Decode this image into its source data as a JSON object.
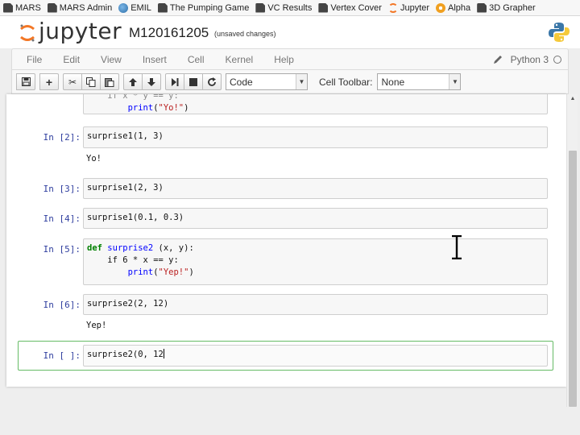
{
  "bookmarks": [
    {
      "label": "MARS",
      "icon": "page-icon"
    },
    {
      "label": "MARS Admin",
      "icon": "page-icon"
    },
    {
      "label": "EMIL",
      "icon": "globe-icon"
    },
    {
      "label": "The Pumping Game",
      "icon": "page-icon"
    },
    {
      "label": "VC Results",
      "icon": "page-icon"
    },
    {
      "label": "Vertex Cover",
      "icon": "page-icon"
    },
    {
      "label": "Jupyter",
      "icon": "jupyter-icon"
    },
    {
      "label": "Alpha",
      "icon": "gear-icon"
    },
    {
      "label": "3D Grapher",
      "icon": "page-icon"
    }
  ],
  "header": {
    "logo_text": "jupyter",
    "notebook_title": "M120161205",
    "save_status": "(unsaved changes)"
  },
  "menu": [
    "File",
    "Edit",
    "View",
    "Insert",
    "Cell",
    "Kernel",
    "Help"
  ],
  "kernel": {
    "name": "Python 3"
  },
  "toolbar": {
    "cell_type": "Code",
    "cell_toolbar_label": "Cell Toolbar:",
    "cell_toolbar_value": "None"
  },
  "cells": {
    "c1": {
      "code_line1": "if x * y == y:",
      "code_line2": "    print(\"Yo!\")"
    },
    "c2": {
      "prompt": "In [2]:",
      "code": "surprise1(1, 3)",
      "output": "Yo!"
    },
    "c3": {
      "prompt": "In [3]:",
      "code": "surprise1(2, 3)"
    },
    "c4": {
      "prompt": "In [4]:",
      "code": "surprise1(0.1, 0.3)"
    },
    "c5": {
      "prompt": "In [5]:",
      "line1_kw": "def",
      "line1_fn": "surprise2",
      "line1_rest": " (x, y):",
      "line2": "if 6 * x == y:",
      "line3_fn": "print",
      "line3_str": "\"Yep!\""
    },
    "c6": {
      "prompt": "In [6]:",
      "code": "surprise2(2, 12)",
      "output": "Yep!"
    },
    "c7": {
      "prompt": "In [ ]:",
      "code": "surprise2(0, 12"
    }
  }
}
